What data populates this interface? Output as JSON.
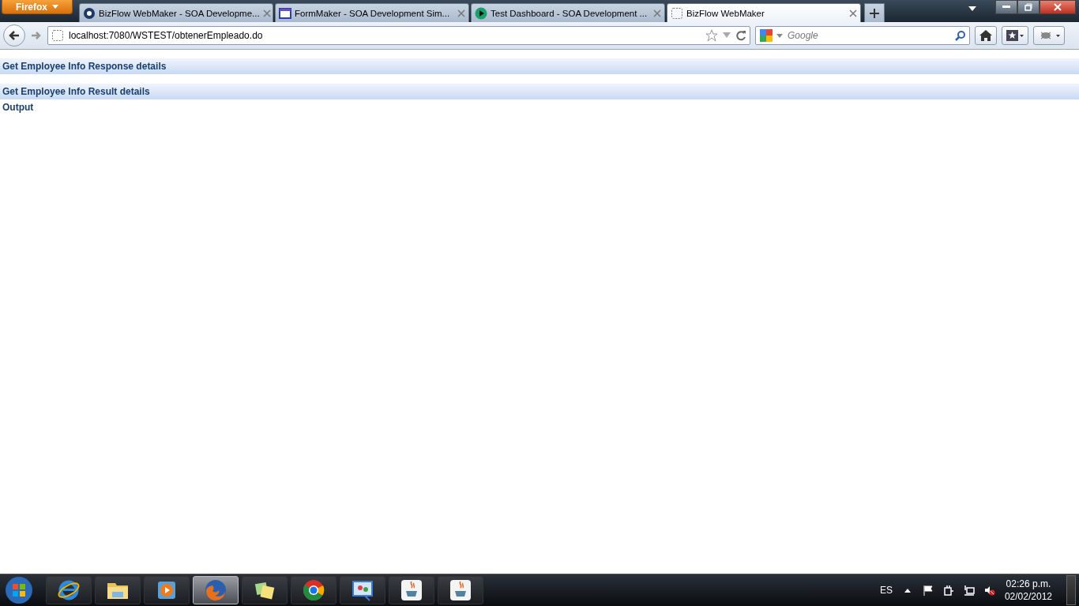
{
  "browser": {
    "menu_button": "Firefox",
    "tabs": [
      {
        "title": "BizFlow WebMaker - SOA Developme...",
        "selected": false
      },
      {
        "title": "FormMaker - SOA Development Sim...",
        "selected": false
      },
      {
        "title": "Test Dashboard - SOA Development ...",
        "selected": false
      },
      {
        "title": "BizFlow WebMaker",
        "selected": true
      }
    ],
    "url": "localhost:7080/WSTEST/obtenerEmpleado.do",
    "search": {
      "placeholder": "Google"
    }
  },
  "page": {
    "sections": [
      {
        "heading": "Get Employee Info Response details"
      },
      {
        "heading": "Get Employee Info Result details"
      }
    ],
    "output_label": "Output"
  },
  "taskbar": {
    "apps": [
      {
        "kind": "ie",
        "selected": false
      },
      {
        "kind": "folder",
        "selected": false
      },
      {
        "kind": "media",
        "selected": false
      },
      {
        "kind": "firefox",
        "selected": true
      },
      {
        "kind": "notes",
        "selected": false
      },
      {
        "kind": "chrome",
        "selected": false
      },
      {
        "kind": "paint",
        "selected": false
      },
      {
        "kind": "java",
        "selected": false
      },
      {
        "kind": "java",
        "selected": false
      }
    ],
    "language": "ES",
    "time": "02:26 p.m.",
    "date": "02/02/2012"
  }
}
